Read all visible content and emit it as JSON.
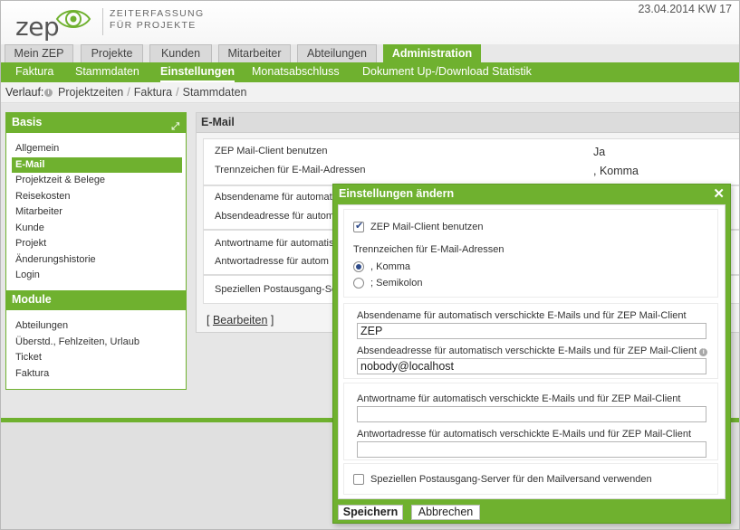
{
  "header": {
    "logo_text": "zep",
    "slogan_line1": "ZEITERFASSUNG",
    "slogan_line2": "FÜR PROJEKTE",
    "date": "23.04.2014 KW 17"
  },
  "tabs": [
    {
      "label": "Mein ZEP",
      "active": false
    },
    {
      "label": "Projekte",
      "active": false
    },
    {
      "label": "Kunden",
      "active": false
    },
    {
      "label": "Mitarbeiter",
      "active": false
    },
    {
      "label": "Abteilungen",
      "active": false
    },
    {
      "label": "Administration",
      "active": true
    }
  ],
  "subnav": [
    {
      "label": "Faktura",
      "active": false
    },
    {
      "label": "Stammdaten",
      "active": false
    },
    {
      "label": "Einstellungen",
      "active": true
    },
    {
      "label": "Monatsabschluss",
      "active": false
    },
    {
      "label": "Dokument Up-/Download Statistik",
      "active": false
    }
  ],
  "breadcrumb": {
    "label": "Verlauf:",
    "items": [
      "Projektzeiten",
      "Faktura",
      "Stammdaten"
    ]
  },
  "sidebar": {
    "basis_title": "Basis",
    "basis_items": [
      {
        "label": "Allgemein",
        "active": false
      },
      {
        "label": "E-Mail",
        "active": true
      },
      {
        "label": "Projektzeit & Belege",
        "active": false
      },
      {
        "label": "Reisekosten",
        "active": false
      },
      {
        "label": "Mitarbeiter",
        "active": false
      },
      {
        "label": "Kunde",
        "active": false
      },
      {
        "label": "Projekt",
        "active": false
      },
      {
        "label": "Änderungshistorie",
        "active": false
      },
      {
        "label": "Login",
        "active": false
      }
    ],
    "module_title": "Module",
    "module_items": [
      {
        "label": "Abteilungen"
      },
      {
        "label": "Überstd., Fehlzeiten, Urlaub"
      },
      {
        "label": "Ticket"
      },
      {
        "label": "Faktura"
      }
    ]
  },
  "main": {
    "title": "E-Mail",
    "rows": {
      "mailclient_label": "ZEP Mail-Client benutzen",
      "mailclient_value": "Ja",
      "separator_label": "Trennzeichen für E-Mail-Adressen",
      "separator_value": ", Komma",
      "sender_name_label": "Absendename für automati",
      "sender_addr_label": "Absendeadresse für autom",
      "reply_name_label": "Antwortname für automatis",
      "reply_addr_label": "Antwortadresse für autom",
      "postout_label": "Speziellen Postausgang-Se"
    },
    "edit_prefix": "[",
    "edit_label": "Bearbeiten",
    "edit_suffix": "]"
  },
  "dialog": {
    "title": "Einstellungen ändern",
    "close_glyph": "✕",
    "mailclient_checkbox_label": "ZEP Mail-Client benutzen",
    "mailclient_checked": true,
    "separator_label": "Trennzeichen für E-Mail-Adressen",
    "separator_options": [
      {
        "label": ", Komma",
        "selected": true
      },
      {
        "label": "; Semikolon",
        "selected": false
      }
    ],
    "sender_name_label": "Absendename für automatisch verschickte E-Mails und für ZEP Mail-Client",
    "sender_name_value": "ZEP",
    "sender_addr_label": "Absendeadresse für automatisch verschickte E-Mails und für ZEP Mail-Client",
    "sender_addr_value": "nobody@localhost",
    "reply_name_label": "Antwortname für automatisch verschickte E-Mails und für ZEP Mail-Client",
    "reply_name_value": "",
    "reply_addr_label": "Antwortadresse für automatisch verschickte E-Mails und für ZEP Mail-Client",
    "reply_addr_value": "",
    "postout_label": "Speziellen Postausgang-Server für den Mailversand verwenden",
    "postout_checked": false,
    "save_label": "Speichern",
    "cancel_label": "Abbrechen"
  },
  "colors": {
    "accent": "#6fb12f",
    "radio_fill": "#2f4b8a"
  }
}
